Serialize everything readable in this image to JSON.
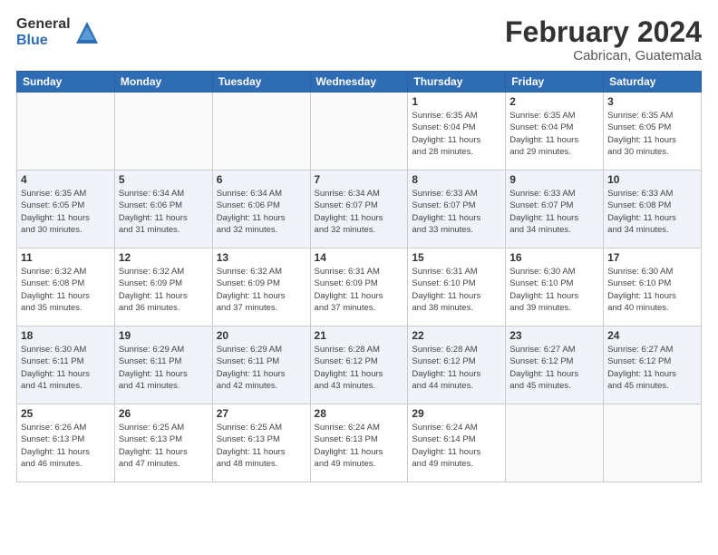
{
  "header": {
    "logo_general": "General",
    "logo_blue": "Blue",
    "month_title": "February 2024",
    "location": "Cabrican, Guatemala"
  },
  "weekdays": [
    "Sunday",
    "Monday",
    "Tuesday",
    "Wednesday",
    "Thursday",
    "Friday",
    "Saturday"
  ],
  "weeks": [
    [
      {
        "day": "",
        "info": ""
      },
      {
        "day": "",
        "info": ""
      },
      {
        "day": "",
        "info": ""
      },
      {
        "day": "",
        "info": ""
      },
      {
        "day": "1",
        "info": "Sunrise: 6:35 AM\nSunset: 6:04 PM\nDaylight: 11 hours\nand 28 minutes."
      },
      {
        "day": "2",
        "info": "Sunrise: 6:35 AM\nSunset: 6:04 PM\nDaylight: 11 hours\nand 29 minutes."
      },
      {
        "day": "3",
        "info": "Sunrise: 6:35 AM\nSunset: 6:05 PM\nDaylight: 11 hours\nand 30 minutes."
      }
    ],
    [
      {
        "day": "4",
        "info": "Sunrise: 6:35 AM\nSunset: 6:05 PM\nDaylight: 11 hours\nand 30 minutes."
      },
      {
        "day": "5",
        "info": "Sunrise: 6:34 AM\nSunset: 6:06 PM\nDaylight: 11 hours\nand 31 minutes."
      },
      {
        "day": "6",
        "info": "Sunrise: 6:34 AM\nSunset: 6:06 PM\nDaylight: 11 hours\nand 32 minutes."
      },
      {
        "day": "7",
        "info": "Sunrise: 6:34 AM\nSunset: 6:07 PM\nDaylight: 11 hours\nand 32 minutes."
      },
      {
        "day": "8",
        "info": "Sunrise: 6:33 AM\nSunset: 6:07 PM\nDaylight: 11 hours\nand 33 minutes."
      },
      {
        "day": "9",
        "info": "Sunrise: 6:33 AM\nSunset: 6:07 PM\nDaylight: 11 hours\nand 34 minutes."
      },
      {
        "day": "10",
        "info": "Sunrise: 6:33 AM\nSunset: 6:08 PM\nDaylight: 11 hours\nand 34 minutes."
      }
    ],
    [
      {
        "day": "11",
        "info": "Sunrise: 6:32 AM\nSunset: 6:08 PM\nDaylight: 11 hours\nand 35 minutes."
      },
      {
        "day": "12",
        "info": "Sunrise: 6:32 AM\nSunset: 6:09 PM\nDaylight: 11 hours\nand 36 minutes."
      },
      {
        "day": "13",
        "info": "Sunrise: 6:32 AM\nSunset: 6:09 PM\nDaylight: 11 hours\nand 37 minutes."
      },
      {
        "day": "14",
        "info": "Sunrise: 6:31 AM\nSunset: 6:09 PM\nDaylight: 11 hours\nand 37 minutes."
      },
      {
        "day": "15",
        "info": "Sunrise: 6:31 AM\nSunset: 6:10 PM\nDaylight: 11 hours\nand 38 minutes."
      },
      {
        "day": "16",
        "info": "Sunrise: 6:30 AM\nSunset: 6:10 PM\nDaylight: 11 hours\nand 39 minutes."
      },
      {
        "day": "17",
        "info": "Sunrise: 6:30 AM\nSunset: 6:10 PM\nDaylight: 11 hours\nand 40 minutes."
      }
    ],
    [
      {
        "day": "18",
        "info": "Sunrise: 6:30 AM\nSunset: 6:11 PM\nDaylight: 11 hours\nand 41 minutes."
      },
      {
        "day": "19",
        "info": "Sunrise: 6:29 AM\nSunset: 6:11 PM\nDaylight: 11 hours\nand 41 minutes."
      },
      {
        "day": "20",
        "info": "Sunrise: 6:29 AM\nSunset: 6:11 PM\nDaylight: 11 hours\nand 42 minutes."
      },
      {
        "day": "21",
        "info": "Sunrise: 6:28 AM\nSunset: 6:12 PM\nDaylight: 11 hours\nand 43 minutes."
      },
      {
        "day": "22",
        "info": "Sunrise: 6:28 AM\nSunset: 6:12 PM\nDaylight: 11 hours\nand 44 minutes."
      },
      {
        "day": "23",
        "info": "Sunrise: 6:27 AM\nSunset: 6:12 PM\nDaylight: 11 hours\nand 45 minutes."
      },
      {
        "day": "24",
        "info": "Sunrise: 6:27 AM\nSunset: 6:12 PM\nDaylight: 11 hours\nand 45 minutes."
      }
    ],
    [
      {
        "day": "25",
        "info": "Sunrise: 6:26 AM\nSunset: 6:13 PM\nDaylight: 11 hours\nand 46 minutes."
      },
      {
        "day": "26",
        "info": "Sunrise: 6:25 AM\nSunset: 6:13 PM\nDaylight: 11 hours\nand 47 minutes."
      },
      {
        "day": "27",
        "info": "Sunrise: 6:25 AM\nSunset: 6:13 PM\nDaylight: 11 hours\nand 48 minutes."
      },
      {
        "day": "28",
        "info": "Sunrise: 6:24 AM\nSunset: 6:13 PM\nDaylight: 11 hours\nand 49 minutes."
      },
      {
        "day": "29",
        "info": "Sunrise: 6:24 AM\nSunset: 6:14 PM\nDaylight: 11 hours\nand 49 minutes."
      },
      {
        "day": "",
        "info": ""
      },
      {
        "day": "",
        "info": ""
      }
    ]
  ]
}
